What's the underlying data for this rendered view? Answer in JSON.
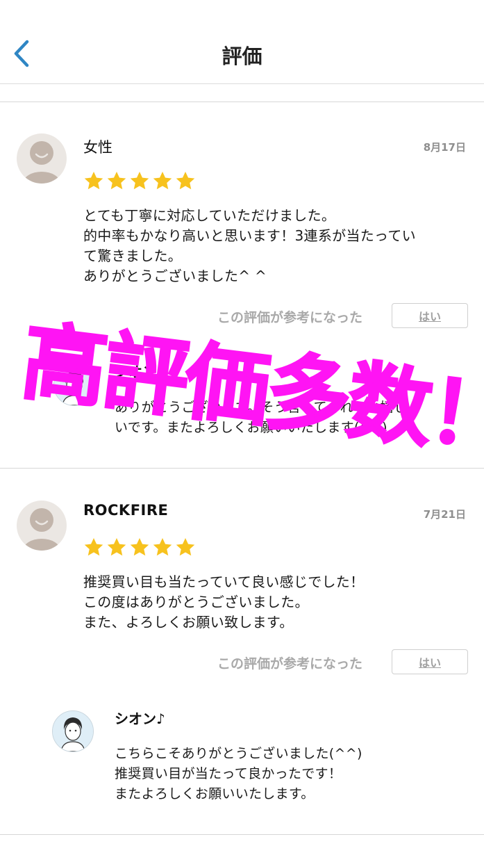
{
  "header": {
    "title": "評価",
    "back_icon": "chevron-left-icon",
    "accent_color": "#2f86c4"
  },
  "reviews": [
    {
      "user": "女性",
      "date": "8月17日",
      "rating": 5,
      "text_lines": [
        "とても丁寧に対応していただけました。",
        "的中率もかなり高いと思います！3連系が当たってい",
        "て驚きました。",
        "ありがとうございました^ ^"
      ],
      "helpful_label": "この評価が参考になった",
      "helpful_button": "はい",
      "reply": {
        "name": "シオン♪",
        "text_lines": [
          "ありがとうございます。そう言ってくれると嬉し",
          "いです。またよろしくお願いいたします(^^)"
        ]
      }
    },
    {
      "user": "ROCKFIRE",
      "date": "7月21日",
      "rating": 5,
      "text_lines": [
        "推奨買い目も当たっていて良い感じでした！",
        "この度はありがとうございました。",
        "また、よろしくお願い致します。"
      ],
      "helpful_label": "この評価が参考になった",
      "helpful_button": "はい",
      "reply": {
        "name": "シオン♪",
        "text_lines": [
          "こちらこそありがとうございました(^^)",
          "推奨買い目が当たって良かったです！",
          "またよろしくお願いいたします。"
        ]
      }
    }
  ],
  "overlay": {
    "text": "高評価多数！",
    "color": "#ff14f4"
  },
  "star_color": "#f7c21e"
}
